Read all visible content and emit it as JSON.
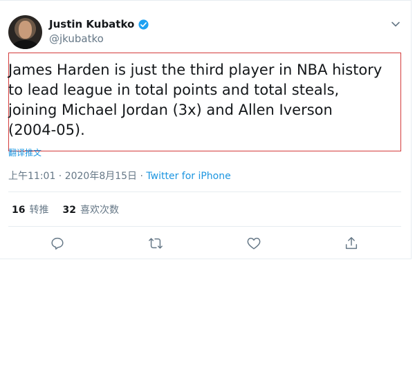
{
  "tweet": {
    "display_name": "Justin Kubatko",
    "handle": "@jkubatko",
    "text": "James Harden is just the third player in NBA history\nto lead league in total points and total steals,\njoining Michael Jordan (3x) and Allen Iverson\n(2004-05).",
    "translate_label": "翻译推文",
    "timestamp": "上午11:01 · 2020年8月15日 · ",
    "source": "Twitter for iPhone",
    "retweets_count": "16",
    "retweets_label": "转推",
    "likes_count": "32",
    "likes_label": "喜欢次数"
  },
  "colors": {
    "accent": "#1b95e0",
    "muted": "#657786",
    "border": "#e6ecf0",
    "highlight_box": "#d33a3a"
  },
  "icons": [
    "verified-badge-icon",
    "chevron-down-icon",
    "reply-icon",
    "retweet-icon",
    "like-icon",
    "share-icon"
  ]
}
